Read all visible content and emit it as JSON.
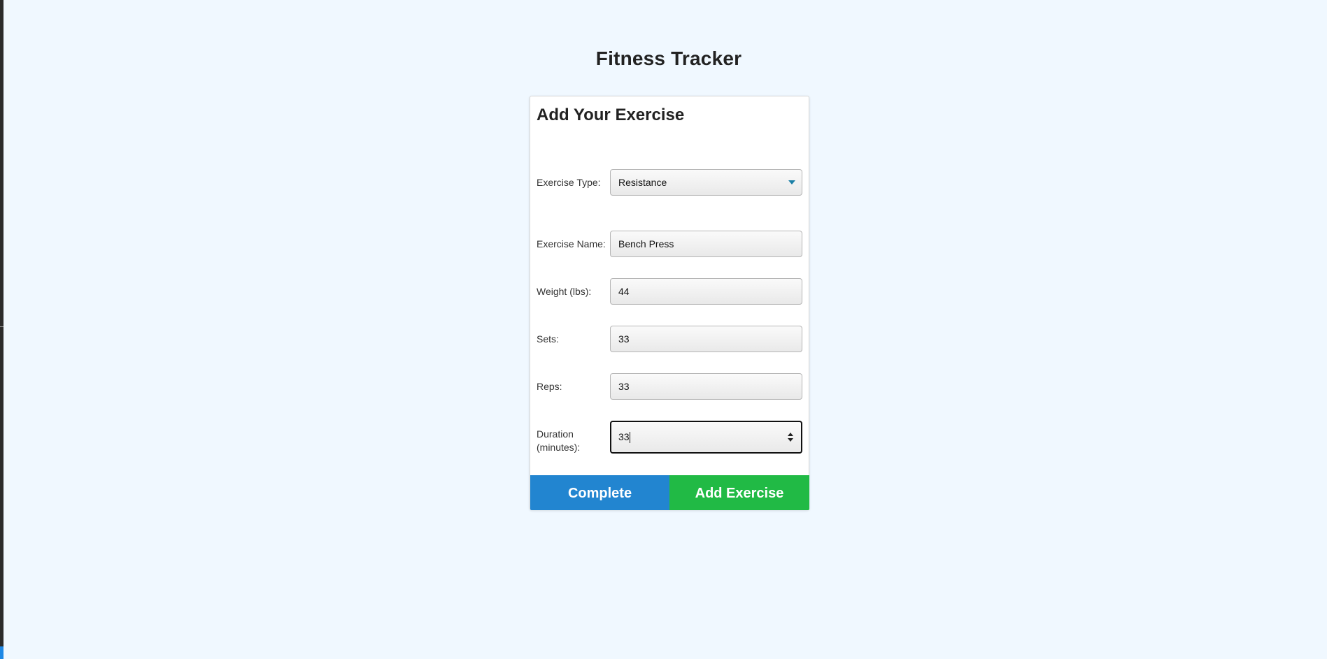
{
  "page": {
    "title": "Fitness Tracker"
  },
  "form": {
    "title": "Add Your Exercise",
    "exercise_type": {
      "label": "Exercise Type:",
      "selected": "Resistance"
    },
    "exercise_name": {
      "label": "Exercise Name:",
      "value": "Bench Press"
    },
    "weight": {
      "label": "Weight (lbs):",
      "value": "44"
    },
    "sets": {
      "label": "Sets:",
      "value": "33"
    },
    "reps": {
      "label": "Reps:",
      "value": "33"
    },
    "duration": {
      "label_line1": "Duration",
      "label_line2": "(minutes):",
      "value": "33"
    },
    "buttons": {
      "complete": "Complete",
      "add": "Add Exercise"
    }
  },
  "colors": {
    "background": "#f0f8ff",
    "complete_button": "#2285d0",
    "add_button": "#21ba45",
    "select_arrow": "#1a7fa6"
  },
  "icons": {
    "select_arrow": "triangle-down",
    "number_spinner": "up-down-arrows"
  }
}
